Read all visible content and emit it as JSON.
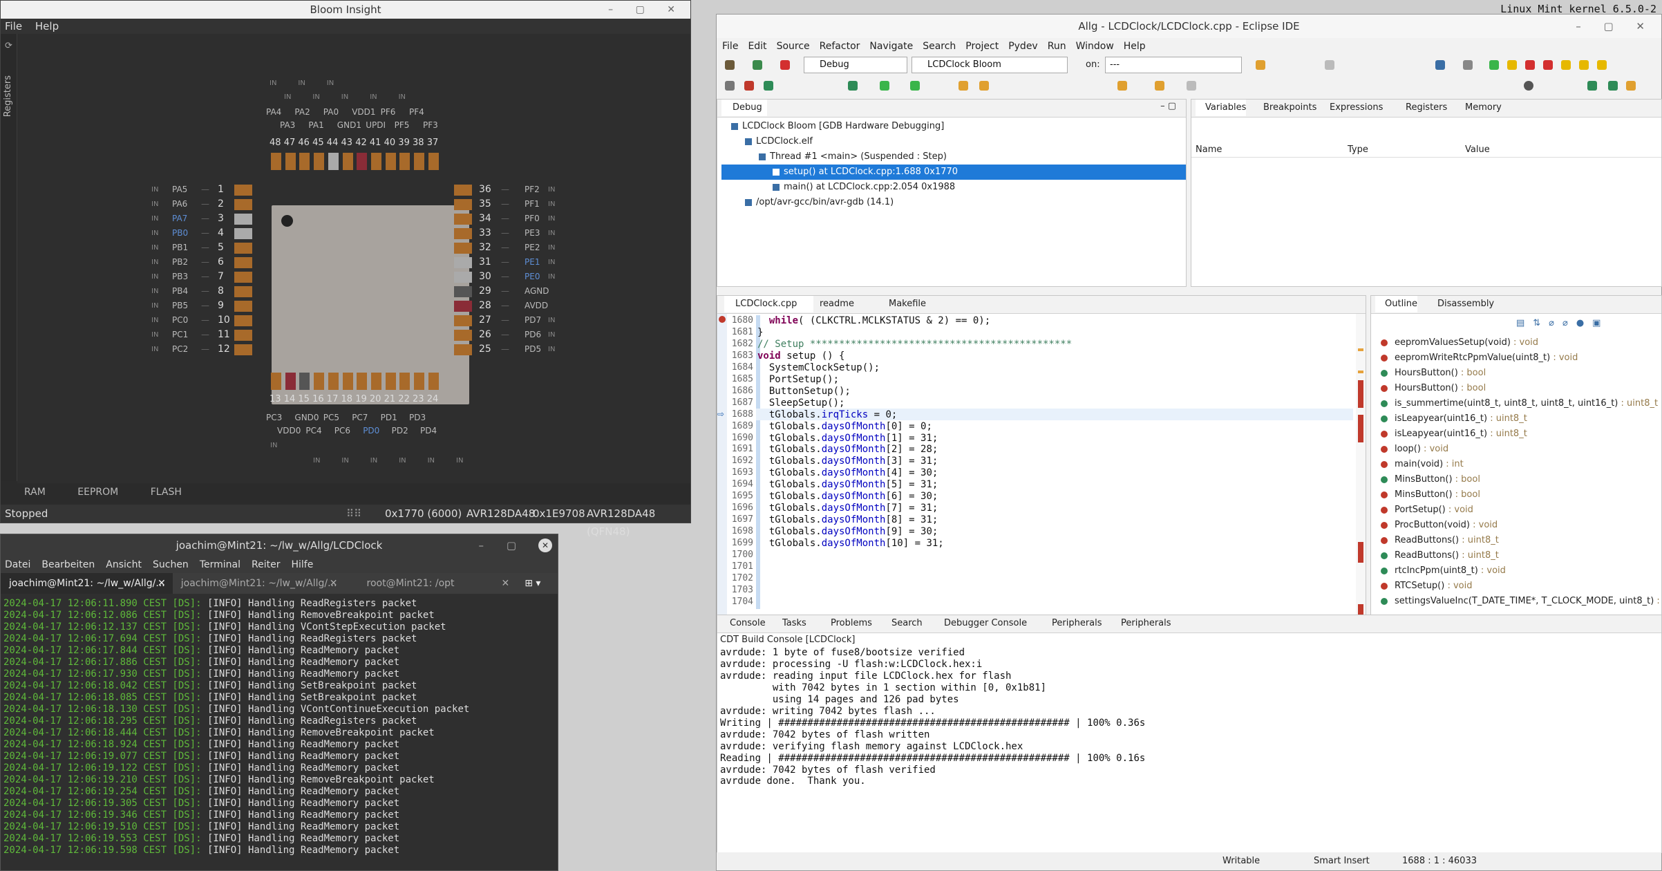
{
  "topbar": {
    "text": "Linux Mint kernel 6.5.0-2"
  },
  "bloom": {
    "title": "Bloom Insight",
    "menu": [
      "File",
      "Help"
    ],
    "sidebar_label": "Registers",
    "top_pins": {
      "io_row1": [
        "IN",
        "IN",
        "IN"
      ],
      "io_row2": [
        "IN",
        "IN",
        "IN",
        "IN",
        "IN"
      ],
      "names_row1": [
        "PA4",
        "PA2",
        "PA0",
        "VDD1",
        "PF6",
        "PF4"
      ],
      "names_row2": [
        "PA3",
        "PA1",
        "GND1",
        "UPDI",
        "PF5",
        "PF3"
      ],
      "numbers": [
        "48",
        "47",
        "46",
        "45",
        "44",
        "43",
        "42",
        "41",
        "40",
        "39",
        "38",
        "37"
      ]
    },
    "left_pins": [
      {
        "io": "IN",
        "name": "PA5",
        "num": "1"
      },
      {
        "io": "IN",
        "name": "PA6",
        "num": "2"
      },
      {
        "io": "IN",
        "name": "PA7",
        "num": "3"
      },
      {
        "io": "IN",
        "name": "PB0",
        "num": "4"
      },
      {
        "io": "IN",
        "name": "PB1",
        "num": "5"
      },
      {
        "io": "IN",
        "name": "PB2",
        "num": "6"
      },
      {
        "io": "IN",
        "name": "PB3",
        "num": "7"
      },
      {
        "io": "IN",
        "name": "PB4",
        "num": "8"
      },
      {
        "io": "IN",
        "name": "PB5",
        "num": "9"
      },
      {
        "io": "IN",
        "name": "PC0",
        "num": "10"
      },
      {
        "io": "IN",
        "name": "PC1",
        "num": "11"
      },
      {
        "io": "IN",
        "name": "PC2",
        "num": "12"
      }
    ],
    "right_pins": [
      {
        "io": "IN",
        "name": "PF2",
        "num": "36"
      },
      {
        "io": "IN",
        "name": "PF1",
        "num": "35"
      },
      {
        "io": "IN",
        "name": "PF0",
        "num": "34"
      },
      {
        "io": "IN",
        "name": "PE3",
        "num": "33"
      },
      {
        "io": "IN",
        "name": "PE2",
        "num": "32"
      },
      {
        "io": "IN",
        "name": "PE1",
        "num": "31"
      },
      {
        "io": "IN",
        "name": "PE0",
        "num": "30"
      },
      {
        "io": "",
        "name": "AGND",
        "num": "29"
      },
      {
        "io": "",
        "name": "AVDD",
        "num": "28"
      },
      {
        "io": "IN",
        "name": "PD7",
        "num": "27"
      },
      {
        "io": "IN",
        "name": "PD6",
        "num": "26"
      },
      {
        "io": "IN",
        "name": "PD5",
        "num": "25"
      }
    ],
    "bottom_pins": {
      "numbers": [
        "13",
        "14",
        "15",
        "16",
        "17",
        "18",
        "19",
        "20",
        "21",
        "22",
        "23",
        "24"
      ],
      "names_row1": [
        "PC3",
        "GND0",
        "PC5",
        "PC7",
        "PD1",
        "PD3"
      ],
      "names_row2": [
        "VDD0",
        "PC4",
        "PC6",
        "PD0",
        "PD2",
        "PD4"
      ],
      "io_row1": [
        "IN"
      ],
      "io_row2": [
        "IN",
        "IN",
        "IN",
        "IN",
        "IN",
        "IN"
      ]
    },
    "tabs": [
      "RAM",
      "EEPROM",
      "FLASH"
    ],
    "status": {
      "state": "Stopped",
      "pc": "0x1770 (6000)",
      "sig_name": "AVR128DA48",
      "sig": "0x1E9708",
      "device": "AVR128DA48 (QFN48)"
    }
  },
  "terminal": {
    "title": "joachim@Mint21: ~/lw_w/Allg/LCDClock",
    "menu": [
      "Datei",
      "Bearbeiten",
      "Ansicht",
      "Suchen",
      "Terminal",
      "Reiter",
      "Hilfe"
    ],
    "tabs": [
      "joachim@Mint21: ~/lw_w/Allg/...",
      "joachim@Mint21: ~/lw_w/Allg/...",
      "root@Mint21: /opt"
    ],
    "lines": [
      {
        "ts": "2024-04-17 12:06:11.890 CEST [DS]:",
        "msg": " [INFO] Handling ReadRegisters packet"
      },
      {
        "ts": "2024-04-17 12:06:12.086 CEST [DS]:",
        "msg": " [INFO] Handling RemoveBreakpoint packet"
      },
      {
        "ts": "2024-04-17 12:06:12.137 CEST [DS]:",
        "msg": " [INFO] Handling VContStepExecution packet"
      },
      {
        "ts": "2024-04-17 12:06:17.694 CEST [DS]:",
        "msg": " [INFO] Handling ReadRegisters packet"
      },
      {
        "ts": "2024-04-17 12:06:17.844 CEST [DS]:",
        "msg": " [INFO] Handling ReadMemory packet"
      },
      {
        "ts": "2024-04-17 12:06:17.886 CEST [DS]:",
        "msg": " [INFO] Handling ReadMemory packet"
      },
      {
        "ts": "2024-04-17 12:06:17.930 CEST [DS]:",
        "msg": " [INFO] Handling ReadMemory packet"
      },
      {
        "ts": "2024-04-17 12:06:18.042 CEST [DS]:",
        "msg": " [INFO] Handling SetBreakpoint packet"
      },
      {
        "ts": "2024-04-17 12:06:18.085 CEST [DS]:",
        "msg": " [INFO] Handling SetBreakpoint packet"
      },
      {
        "ts": "2024-04-17 12:06:18.130 CEST [DS]:",
        "msg": " [INFO] Handling VContContinueExecution packet"
      },
      {
        "ts": "2024-04-17 12:06:18.295 CEST [DS]:",
        "msg": " [INFO] Handling ReadRegisters packet"
      },
      {
        "ts": "2024-04-17 12:06:18.444 CEST [DS]:",
        "msg": " [INFO] Handling RemoveBreakpoint packet"
      },
      {
        "ts": "2024-04-17 12:06:18.924 CEST [DS]:",
        "msg": " [INFO] Handling ReadMemory packet"
      },
      {
        "ts": "2024-04-17 12:06:19.077 CEST [DS]:",
        "msg": " [INFO] Handling ReadMemory packet"
      },
      {
        "ts": "2024-04-17 12:06:19.122 CEST [DS]:",
        "msg": " [INFO] Handling ReadMemory packet"
      },
      {
        "ts": "2024-04-17 12:06:19.210 CEST [DS]:",
        "msg": " [INFO] Handling RemoveBreakpoint packet"
      },
      {
        "ts": "2024-04-17 12:06:19.254 CEST [DS]:",
        "msg": " [INFO] Handling ReadMemory packet"
      },
      {
        "ts": "2024-04-17 12:06:19.305 CEST [DS]:",
        "msg": " [INFO] Handling ReadMemory packet"
      },
      {
        "ts": "2024-04-17 12:06:19.346 CEST [DS]:",
        "msg": " [INFO] Handling ReadMemory packet"
      },
      {
        "ts": "2024-04-17 12:06:19.510 CEST [DS]:",
        "msg": " [INFO] Handling ReadMemory packet"
      },
      {
        "ts": "2024-04-17 12:06:19.553 CEST [DS]:",
        "msg": " [INFO] Handling ReadMemory packet"
      },
      {
        "ts": "2024-04-17 12:06:19.598 CEST [DS]:",
        "msg": " [INFO] Handling ReadMemory packet"
      }
    ]
  },
  "eclipse": {
    "title": "Allg - LCDClock/LCDClock.cpp - Eclipse IDE",
    "menu": [
      "File",
      "Edit",
      "Source",
      "Refactor",
      "Navigate",
      "Search",
      "Project",
      "Pydev",
      "Run",
      "Window",
      "Help"
    ],
    "mode_combo": "Debug",
    "config_combo": "LCDClock Bloom",
    "on_label": "on:",
    "target_combo": "---",
    "debug_view": {
      "tab": "Debug",
      "tree": [
        "LCDClock Bloom [GDB Hardware Debugging]",
        "LCDClock.elf",
        "Thread #1 <main> (Suspended : Step)",
        "setup() at LCDClock.cpp:1.688 0x1770",
        "main() at LCDClock.cpp:2.054 0x1988",
        "/opt/avr-gcc/bin/avr-gdb (14.1)"
      ]
    },
    "vars_view": {
      "tabs": [
        "Variables",
        "Breakpoints",
        "Expressions",
        "Registers",
        "Memory"
      ],
      "columns": [
        "Name",
        "Type",
        "Value"
      ]
    },
    "editor": {
      "tabs": [
        "LCDClock.cpp",
        "readme",
        "Makefile"
      ],
      "lines": [
        {
          "n": "1680",
          "t": "  while( (CLKCTRL.MCLKSTATUS & 2) == 0);"
        },
        {
          "n": "1681",
          "t": "}"
        },
        {
          "n": "1682",
          "t": ""
        },
        {
          "n": "1683",
          "t": ""
        },
        {
          "n": "1684",
          "t": "// Setup *********************************************"
        },
        {
          "n": "1685",
          "t": ""
        },
        {
          "n": "1686",
          "t": "void setup () {"
        },
        {
          "n": "1687",
          "t": ""
        },
        {
          "n": "1688",
          "t": "  SystemClockSetup();"
        },
        {
          "n": "1689",
          "t": "  PortSetup();"
        },
        {
          "n": "1690",
          "t": "  ButtonSetup();"
        },
        {
          "n": "1691",
          "t": "  SleepSetup();"
        },
        {
          "n": "1692",
          "t": ""
        },
        {
          "n": "1693",
          "t": "  tGlobals.irqTicks = 0;"
        },
        {
          "n": "1694",
          "t": "  tGlobals.daysOfMonth[0] = 0;"
        },
        {
          "n": "1695",
          "t": "  tGlobals.daysOfMonth[1] = 31;"
        },
        {
          "n": "1696",
          "t": "  tGlobals.daysOfMonth[2] = 28;"
        },
        {
          "n": "1697",
          "t": "  tGlobals.daysOfMonth[3] = 31;"
        },
        {
          "n": "1698",
          "t": "  tGlobals.daysOfMonth[4] = 30;"
        },
        {
          "n": "1699",
          "t": "  tGlobals.daysOfMonth[5] = 31;"
        },
        {
          "n": "1700",
          "t": "  tGlobals.daysOfMonth[6] = 30;"
        },
        {
          "n": "1701",
          "t": "  tGlobals.daysOfMonth[7] = 31;"
        },
        {
          "n": "1702",
          "t": "  tGlobals.daysOfMonth[8] = 31;"
        },
        {
          "n": "1703",
          "t": "  tGlobals.daysOfMonth[9] = 30;"
        },
        {
          "n": "1704",
          "t": "  tGlobals.daysOfMonth[10] = 31;"
        }
      ]
    },
    "outline": {
      "tabs": [
        "Outline",
        "Disassembly"
      ],
      "items": [
        {
          "name": "eepromValuesSetup(void)",
          "type": " : void",
          "c": "#c0392b"
        },
        {
          "name": "eepromWriteRtcPpmValue(uint8_t)",
          "type": " : void",
          "c": "#c0392b"
        },
        {
          "name": "HoursButton()",
          "type": " : bool",
          "c": "#2e8b57"
        },
        {
          "name": "HoursButton()",
          "type": " : bool",
          "c": "#c0392b"
        },
        {
          "name": "is_summertime(uint8_t, uint8_t, uint8_t, uint16_t)",
          "type": " : uint8_t",
          "c": "#2e8b57"
        },
        {
          "name": "isLeapyear(uint16_t)",
          "type": " : uint8_t",
          "c": "#2e8b57"
        },
        {
          "name": "isLeapyear(uint16_t)",
          "type": " : uint8_t",
          "c": "#c0392b"
        },
        {
          "name": "loop()",
          "type": " : void",
          "c": "#c0392b"
        },
        {
          "name": "main(void)",
          "type": " : int",
          "c": "#c0392b"
        },
        {
          "name": "MinsButton()",
          "type": " : bool",
          "c": "#2e8b57"
        },
        {
          "name": "MinsButton()",
          "type": " : bool",
          "c": "#c0392b"
        },
        {
          "name": "PortSetup()",
          "type": " : void",
          "c": "#c0392b"
        },
        {
          "name": "ProcButton(void)",
          "type": " : void",
          "c": "#c0392b"
        },
        {
          "name": "ReadButtons()",
          "type": " : uint8_t",
          "c": "#c0392b"
        },
        {
          "name": "ReadButtons()",
          "type": " : uint8_t",
          "c": "#2e8b57"
        },
        {
          "name": "rtcIncPpm(uint8_t)",
          "type": " : void",
          "c": "#2e8b57"
        },
        {
          "name": "RTCSetup()",
          "type": " : void",
          "c": "#c0392b"
        },
        {
          "name": "settingsValueInc(T_DATE_TIME*, T_CLOCK_MODE, uint8_t)",
          "type": " : ",
          "c": "#2e8b57"
        }
      ]
    },
    "console": {
      "tabs": [
        "Console",
        "Tasks",
        "Problems",
        "Search",
        "Debugger Console",
        "Peripherals",
        "Peripherals"
      ],
      "header": "CDT Build Console [LCDClock]",
      "lines": [
        "avrdude: 1 byte of fuse8/bootsize verified",
        "",
        "avrdude: processing -U flash:w:LCDClock.hex:i",
        "avrdude: reading input file LCDClock.hex for flash",
        "         with 7042 bytes in 1 section within [0, 0x1b81]",
        "         using 14 pages and 126 pad bytes",
        "avrdude: writing 7042 bytes flash ...",
        "Writing | ################################################## | 100% 0.36s",
        "avrdude: 7042 bytes of flash written",
        "avrdude: verifying flash memory against LCDClock.hex",
        "Reading | ################################################## | 100% 0.16s",
        "avrdude: 7042 bytes of flash verified",
        "",
        "avrdude done.  Thank you."
      ]
    },
    "status": {
      "writable": "Writable",
      "insert": "Smart Insert",
      "pos": "1688 : 1 : 46033"
    }
  }
}
